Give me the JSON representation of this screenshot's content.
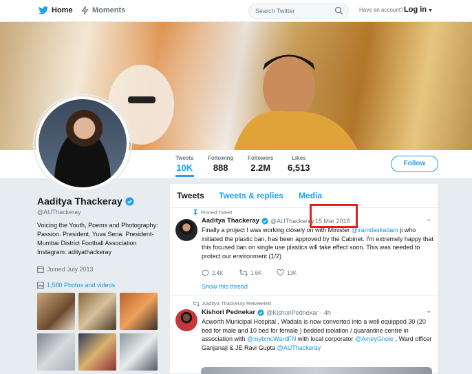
{
  "nav": {
    "home_label": "Home",
    "moments_label": "Moments",
    "search_placeholder": "Search Twitter",
    "account_prompt": "Have an account?",
    "login_label": "Log in"
  },
  "profile": {
    "name": "Aaditya Thackeray",
    "handle": "@AUThackeray",
    "bio": "Voicing the Youth, Poems and Photography: Passion. President, Yuva Sena. President- Mumbai District Football Association Instagram: adityathackeray",
    "joined": "Joined July 2013",
    "photos_link": "1,580 Photos and videos",
    "follow_label": "Follow"
  },
  "stats": [
    {
      "label": "Tweets",
      "value": "10K"
    },
    {
      "label": "Following",
      "value": "888"
    },
    {
      "label": "Followers",
      "value": "2.2M"
    },
    {
      "label": "Likes",
      "value": "6,513"
    }
  ],
  "tabs": [
    "Tweets",
    "Tweets & replies",
    "Media"
  ],
  "tweets": [
    {
      "context": "Pinned Tweet",
      "name": "Aaditya Thackeray",
      "handle": "@AUThackeray",
      "date": "15 Mar 2018",
      "text_a": "Finally a project I was working closely on with Minister ",
      "mention": "@iramdaskadam",
      "text_b": " ji who initiated the plastic ban, has been approved by the Cabinet. I'm extremely happy that this focused ban on single use plastics will take effect soon. This was needed to protect our environment (1/2)",
      "replies": "2.4K",
      "retweets": "1.6K",
      "likes": "13K",
      "show_thread": "Show this thread"
    },
    {
      "context": "Aaditya Thackeray Retweeted",
      "name": "Kishori Pednekar",
      "handle": "@KishoriPednekar",
      "date": "· 4h",
      "text_a": "Acworth Municipal Hospital , Wadala is now converted into a well equipped 30 (20 bed for male and 10 bed for female ) bedded isolation / quarantine centre in association with ",
      "mention1": "@mybmcWardFN",
      "text_b": " with local corporator ",
      "mention2": "@AmeyGhole",
      "text_c": " , Ward officer Ganjanaji  & JE Ravi Gupta ",
      "mention3": "@AUThackeray"
    }
  ],
  "colors": {
    "accent": "#1da1f2",
    "highlight_box": "#e0201b",
    "background": "#e6ecf0"
  }
}
